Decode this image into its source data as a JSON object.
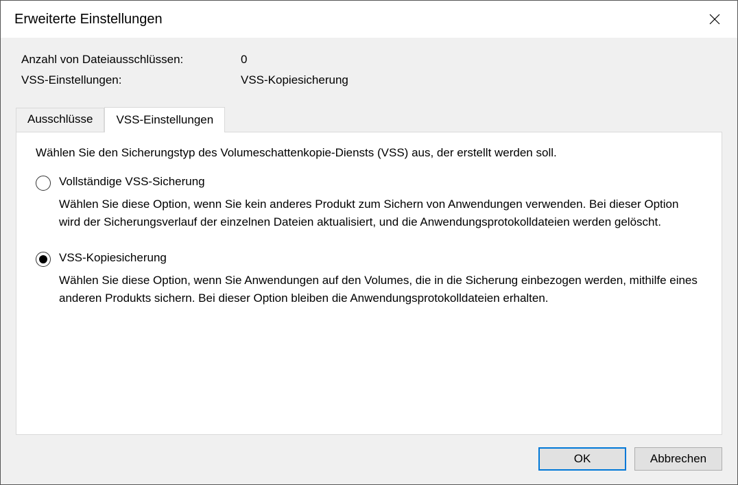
{
  "dialog": {
    "title": "Erweiterte Einstellungen"
  },
  "summary": {
    "exclusions_label": "Anzahl von Dateiausschlüssen:",
    "exclusions_value": "0",
    "vss_label": "VSS-Einstellungen:",
    "vss_value": "VSS-Kopiesicherung"
  },
  "tabs": {
    "exclusions": "Ausschlüsse",
    "vss": "VSS-Einstellungen"
  },
  "panel": {
    "instruction": "Wählen Sie den Sicherungstyp des Volumeschattenkopie-Diensts (VSS) aus, der erstellt werden soll.",
    "option_full_title": "Vollständige VSS-Sicherung",
    "option_full_desc": "Wählen Sie diese Option, wenn Sie kein anderes Produkt zum Sichern von Anwendungen verwenden. Bei dieser Option wird der Sicherungsverlauf der einzelnen Dateien aktualisiert, und die Anwendungsprotokolldateien werden gelöscht.",
    "option_copy_title": "VSS-Kopiesicherung",
    "option_copy_desc": "Wählen Sie diese Option, wenn Sie Anwendungen auf den Volumes, die in die Sicherung einbezogen werden, mithilfe eines anderen Produkts sichern. Bei dieser Option bleiben die Anwendungsprotokolldateien erhalten."
  },
  "buttons": {
    "ok": "OK",
    "cancel": "Abbrechen"
  }
}
